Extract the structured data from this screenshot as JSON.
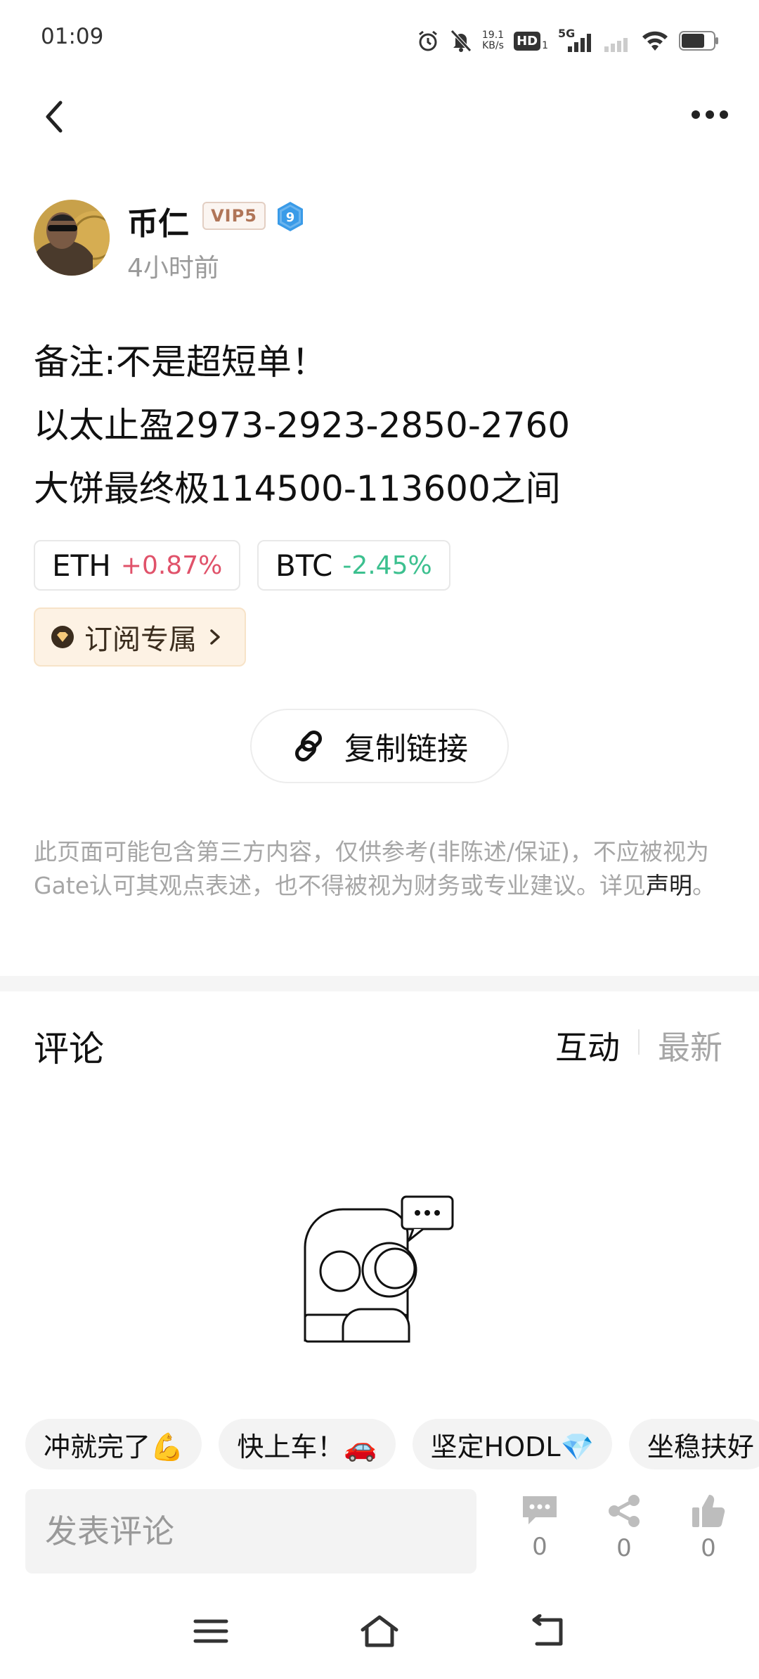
{
  "status_bar": {
    "time": "01:09",
    "net_speed_value": "19.1",
    "net_speed_unit": "KB/s",
    "hd_label": "HD",
    "hd_sub": "1",
    "network": "5G"
  },
  "author": {
    "name": "币仁",
    "vip": "VIP5",
    "level": "9",
    "time": "4小时前"
  },
  "post": {
    "lines": [
      "备注:不是超短单！",
      "以太止盈2973-2923-2850-2760",
      "大饼最终极114500-113600之间"
    ]
  },
  "tickers": [
    {
      "symbol": "ETH",
      "change": "+0.87%",
      "direction": "up"
    },
    {
      "symbol": "BTC",
      "change": "-2.45%",
      "direction": "down"
    }
  ],
  "subscribe_label": "订阅专属",
  "copy_link_label": "复制链接",
  "disclaimer": {
    "text": "此页面可能包含第三方内容，仅供参考(非陈述/保证)，不应被视为Gate认可其观点表述，也不得被视为财务或专业建议。详见",
    "link": "声明",
    "end": "。"
  },
  "comments": {
    "title": "评论",
    "sort_hot": "互动",
    "sort_new": "最新"
  },
  "quick_replies": [
    "冲就完了💪",
    "快上车！🚗",
    "坚定HODL💎",
    "坐稳扶好"
  ],
  "bottom_bar": {
    "input_placeholder": "发表评论",
    "comment_count": "0",
    "share_count": "0",
    "like_count": "0"
  },
  "colors": {
    "up": "#e0526a",
    "down": "#3cc08f",
    "vip": "#b07558",
    "level_badge": "#3a9be8",
    "subscribe_bg": "#fdf2e4",
    "muted": "#a6a6a6"
  }
}
